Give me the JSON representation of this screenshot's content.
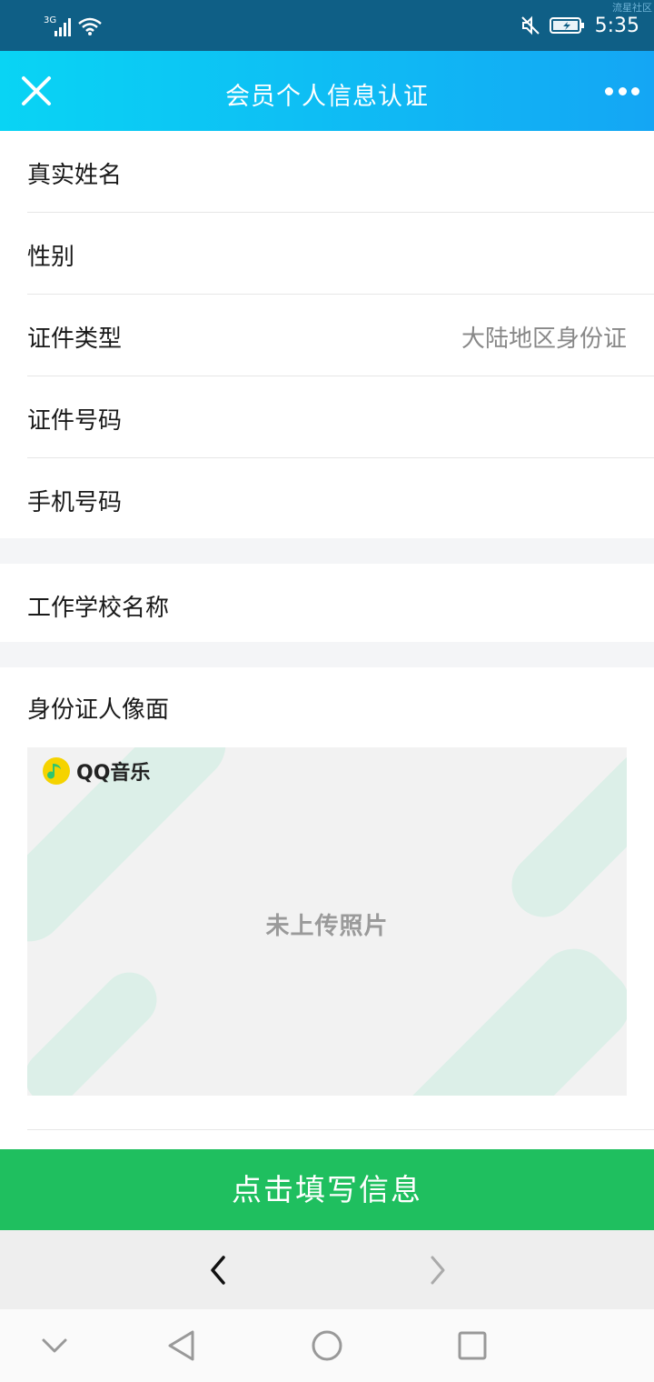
{
  "status_bar": {
    "network": "3G",
    "time": "5:35",
    "watermark": "流星社区"
  },
  "nav": {
    "title": "会员个人信息认证"
  },
  "form": {
    "rows": [
      {
        "label": "真实姓名",
        "value": ""
      },
      {
        "label": "性别",
        "value": ""
      },
      {
        "label": "证件类型",
        "value": "大陆地区身份证"
      },
      {
        "label": "证件号码",
        "value": ""
      },
      {
        "label": "手机号码",
        "value": ""
      }
    ],
    "school_label": "工作学校名称",
    "id_photo": {
      "label": "身份证人像面",
      "logo_text": "QQ音乐",
      "placeholder": "未上传照片"
    }
  },
  "cta_label": "点击填写信息",
  "colors": {
    "nav_gradient_start": "#09d4f4",
    "nav_gradient_end": "#14a6f4",
    "cta": "#1fbf5f",
    "logo_yellow": "#f5d300",
    "logo_green": "#2fc56e"
  },
  "icons": {
    "close": "close-icon",
    "more": "more-dots-icon",
    "back": "chevron-left-icon",
    "forward": "chevron-right-icon",
    "sys_down": "chevron-down-icon",
    "sys_back": "triangle-back-icon",
    "sys_home": "circle-home-icon",
    "sys_recent": "square-recent-icon"
  }
}
